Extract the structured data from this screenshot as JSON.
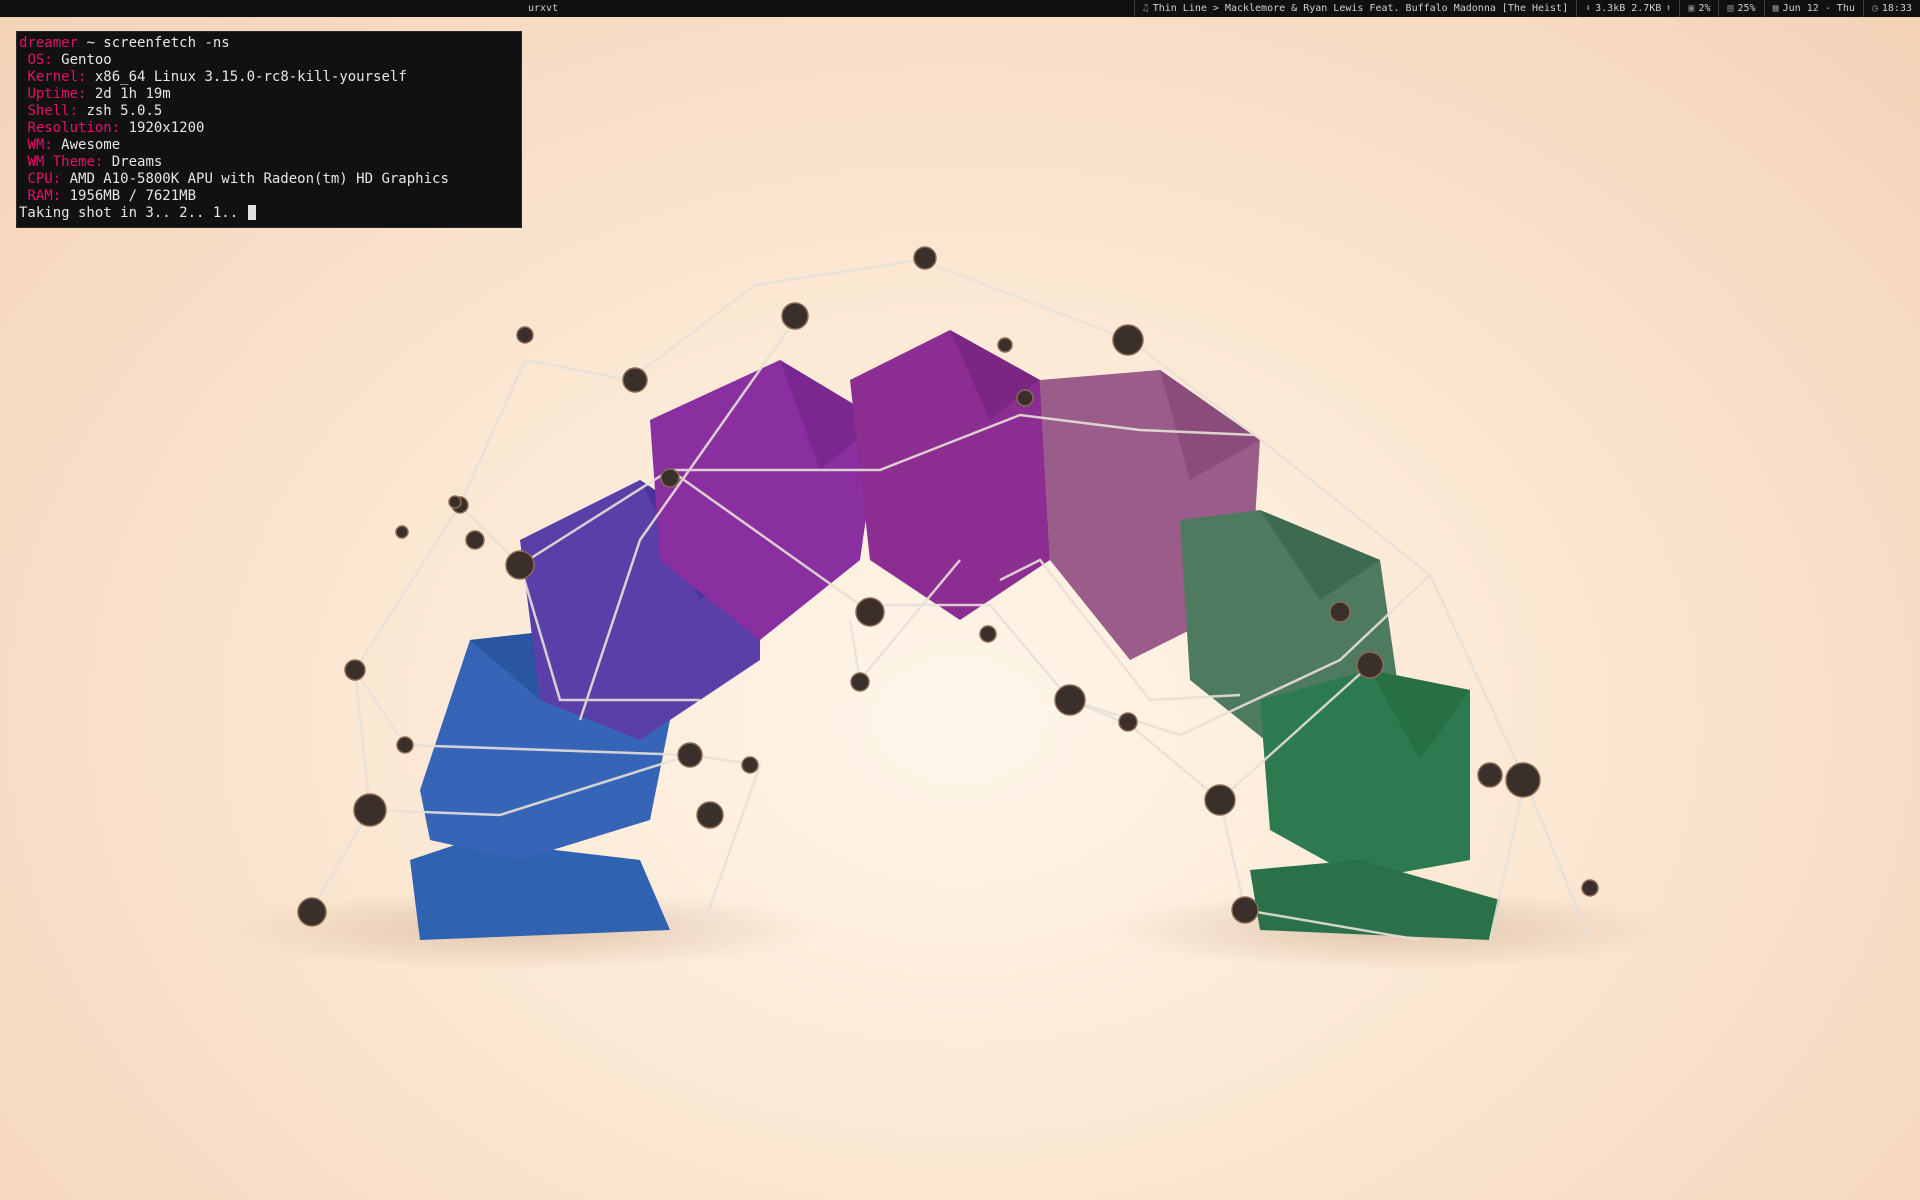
{
  "topbar": {
    "window_title": "urxvt",
    "music": {
      "icon": "music-note-icon",
      "text": "Thin Line > Macklemore & Ryan Lewis Feat. Buffalo Madonna [The Heist]"
    },
    "network": {
      "down_icon": "download-arrow-icon",
      "up_icon": "upload-arrow-icon",
      "text": "3.3kB 2.7KB"
    },
    "cpu": {
      "icon": "cpu-icon",
      "text": "2%"
    },
    "memory": {
      "icon": "memory-icon",
      "text": "25%"
    },
    "date": {
      "icon": "calendar-icon",
      "text": "Jun 12 - Thu"
    },
    "clock": {
      "icon": "clock-icon",
      "text": "18:33"
    }
  },
  "terminal": {
    "prompt_user": "dreamer",
    "prompt_path": " ~",
    "command": " screenfetch -ns",
    "fields": [
      {
        "key": "OS:",
        "value": " Gentoo"
      },
      {
        "key": "Kernel:",
        "value": " x86_64 Linux 3.15.0-rc8-kill-yourself"
      },
      {
        "key": "Uptime:",
        "value": " 2d 1h 19m"
      },
      {
        "key": "Shell:",
        "value": " zsh 5.0.5"
      },
      {
        "key": "Resolution:",
        "value": " 1920x1200"
      },
      {
        "key": "WM:",
        "value": " Awesome"
      },
      {
        "key": "WM Theme:",
        "value": " Dreams"
      },
      {
        "key": "CPU:",
        "value": " AMD A10-5800K APU with Radeon(tm) HD Graphics"
      },
      {
        "key": "RAM:",
        "value": " 1956MB / 7621MB"
      }
    ],
    "last_line": "Taking shot in 3.. 2.. 1.. "
  },
  "colors": {
    "accent": "#e8106a",
    "terminal_bg": "#111111",
    "bar_bg": "#101010"
  }
}
